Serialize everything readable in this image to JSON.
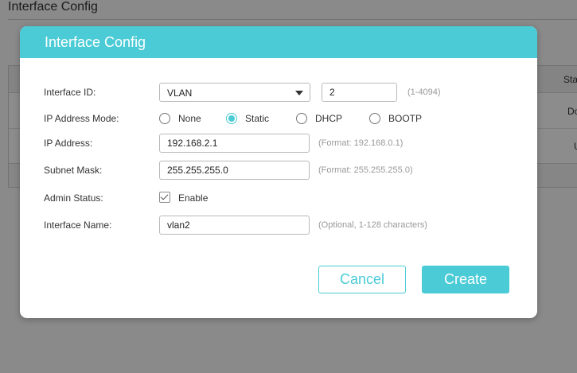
{
  "background": {
    "title": "Interface Config",
    "table": {
      "status_header": "Sta",
      "cells": [
        "Do",
        "U"
      ]
    }
  },
  "dialog": {
    "title": "Interface Config",
    "fields": {
      "interface_id": {
        "label": "Interface ID:",
        "type_value": "VLAN",
        "id_value": "2",
        "hint": "(1-4094)"
      },
      "ip_mode": {
        "label": "IP Address Mode:",
        "options": [
          "None",
          "Static",
          "DHCP",
          "BOOTP"
        ],
        "selected": "Static"
      },
      "ip_address": {
        "label": "IP Address:",
        "value": "192.168.2.1",
        "hint": "(Format: 192.168.0.1)"
      },
      "subnet_mask": {
        "label": "Subnet Mask:",
        "value": "255.255.255.0",
        "hint": "(Format: 255.255.255.0)"
      },
      "admin_status": {
        "label": "Admin Status:",
        "checkbox_label": "Enable",
        "checked": true
      },
      "interface_name": {
        "label": "Interface Name:",
        "value": "vlan2",
        "hint": "(Optional, 1-128 characters)"
      }
    },
    "buttons": {
      "cancel": "Cancel",
      "create": "Create"
    }
  },
  "colors": {
    "accent": "#4acbd6",
    "overlay": "rgba(0,0,0,0.45)",
    "hint_text": "#999999"
  },
  "icons": {
    "dropdown": "chevron-down-icon",
    "radio": "radio-icon",
    "check": "check-icon"
  }
}
